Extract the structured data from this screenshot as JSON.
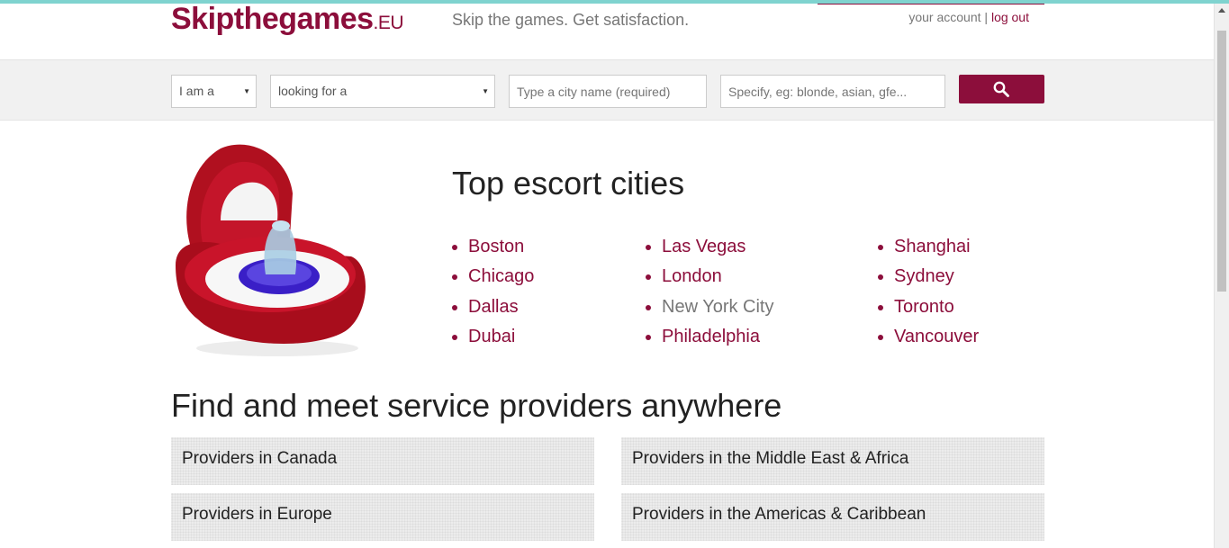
{
  "header": {
    "logo_main": "Skipthegames",
    "logo_tld": ".EU",
    "tagline": "Skip the games. Get satisfaction.",
    "account_link": "your account",
    "separator": "|",
    "logout_link": "log out"
  },
  "search": {
    "iam_value": "I am a",
    "lookingfor_value": "looking for a",
    "city_placeholder": "Type a city name (required)",
    "specify_placeholder": "Specify, eg: blonde, asian, gfe...",
    "button_icon": "search-icon"
  },
  "top_cities": {
    "title": "Top escort cities",
    "columns": [
      [
        "Boston",
        "Chicago",
        "Dallas",
        "Dubai"
      ],
      [
        "Las Vegas",
        "London",
        "New York City",
        "Philadelphia"
      ],
      [
        "Shanghai",
        "Sydney",
        "Toronto",
        "Vancouver"
      ]
    ]
  },
  "find": {
    "title": "Find and meet service providers anywhere",
    "regions": [
      "Providers in Canada",
      "Providers in the Middle East & Africa",
      "Providers in Europe",
      "Providers in the Americas & Caribbean"
    ]
  },
  "colors": {
    "brand": "#8c0e3b",
    "top_line": "#7fd3cf"
  }
}
